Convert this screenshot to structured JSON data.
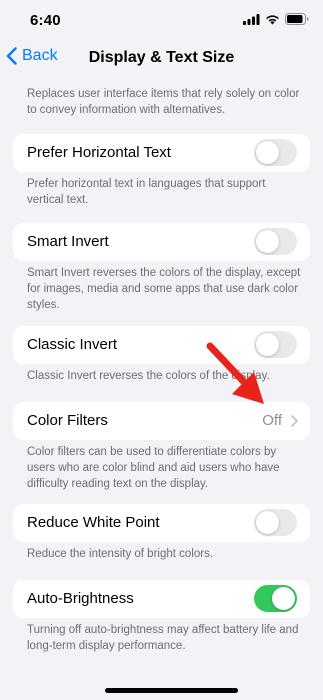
{
  "status": {
    "time": "6:40"
  },
  "nav": {
    "back_label": "Back",
    "title": "Display & Text Size"
  },
  "top_footer": "Replaces user interface items that rely solely on color to convey information with alternatives.",
  "prefer_horizontal": {
    "label": "Prefer Horizontal Text",
    "on": false,
    "footer": "Prefer horizontal text in languages that support vertical text."
  },
  "smart_invert": {
    "label": "Smart Invert",
    "on": false,
    "footer": "Smart Invert reverses the colors of the display, except for images, media and some apps that use dark color styles."
  },
  "classic_invert": {
    "label": "Classic Invert",
    "on": false,
    "footer": "Classic Invert reverses the colors of the display."
  },
  "color_filters": {
    "label": "Color Filters",
    "value": "Off",
    "footer": "Color filters can be used to differentiate colors by users who are color blind and aid users who have difficulty reading text on the display."
  },
  "reduce_white_point": {
    "label": "Reduce White Point",
    "on": false,
    "footer": "Reduce the intensity of bright colors."
  },
  "auto_brightness": {
    "label": "Auto-Brightness",
    "on": true,
    "footer": "Turning off auto-brightness may affect battery life and long-term display performance."
  },
  "colors": {
    "accent": "#007aff",
    "toggle_on": "#34c759",
    "arrow": "#e8231c"
  }
}
